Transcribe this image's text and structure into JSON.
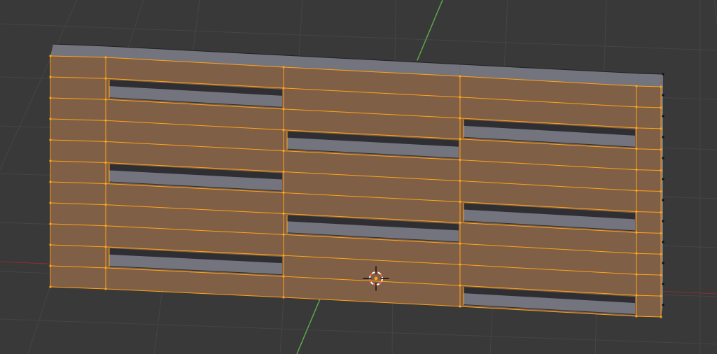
{
  "viewport": {
    "name": "3d-viewport",
    "mode": "edit-mode",
    "selection": "all-faces-selected"
  },
  "colors": {
    "background": "#393939",
    "grid_line": "#454545",
    "axis_x": "#8a2f2f",
    "axis_y": "#5fae45",
    "face_selected": "#7f5f45",
    "face_unselected": "#74747e",
    "face_dark": "#2f2f33",
    "edge_selected": "#ffa31a",
    "vertex_dark": "#111111",
    "cursor_red": "#ff5b40",
    "cursor_white": "#ffffff"
  },
  "mesh": {
    "object": "pallet-side-panel",
    "columns": 3,
    "rows_per_column": 11,
    "openings": [
      {
        "column": 1,
        "row": 1
      },
      {
        "column": 1,
        "row": 5
      },
      {
        "column": 1,
        "row": 9
      },
      {
        "column": 2,
        "row": 3
      },
      {
        "column": 2,
        "row": 7
      },
      {
        "column": 3,
        "row": 2
      },
      {
        "column": 3,
        "row": 6
      },
      {
        "column": 3,
        "row": 10
      }
    ]
  },
  "cursor": {
    "name": "3d-cursor",
    "icon": "crosshair-cursor-icon"
  }
}
